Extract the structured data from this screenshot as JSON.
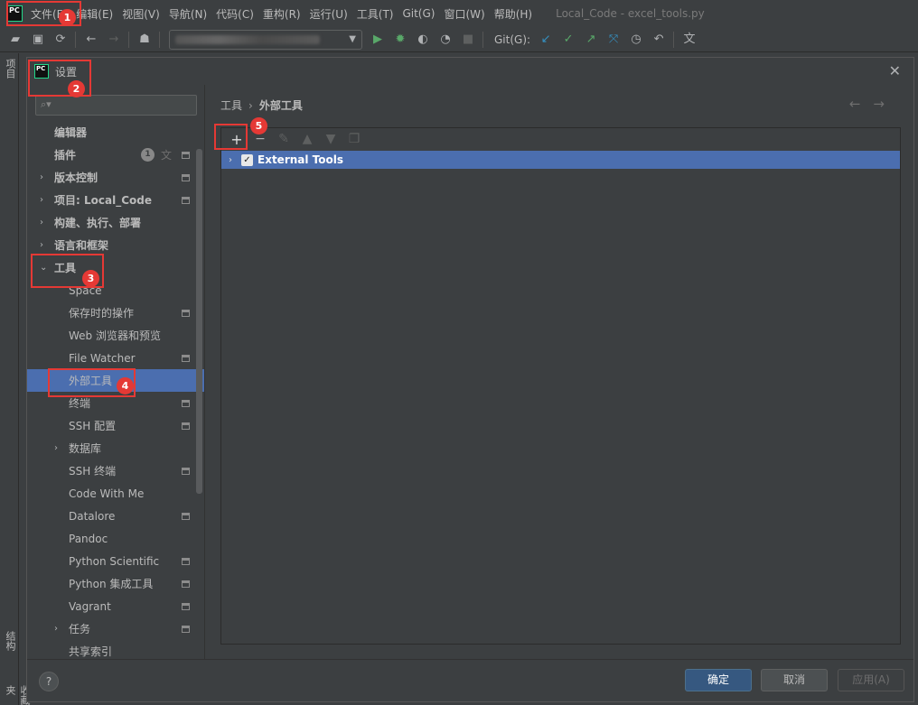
{
  "menu": {
    "items": [
      "文件(F)",
      "编辑(E)",
      "视图(V)",
      "导航(N)",
      "代码(C)",
      "重构(R)",
      "运行(U)",
      "工具(T)",
      "Git(G)",
      "窗口(W)",
      "帮助(H)"
    ],
    "window_title": "Local_Code - excel_tools.py"
  },
  "toolbar": {
    "git_label": "Git(G):"
  },
  "side_strip": {
    "project_tab": "项目",
    "structure_tab": "结构",
    "bookmarks_tab": "收藏夹"
  },
  "dialog": {
    "title": "设置",
    "search_placeholder": "",
    "tree": [
      {
        "label": "编辑器",
        "level": 0,
        "arrow": "",
        "scope": false,
        "badge": "",
        "trans": false
      },
      {
        "label": "插件",
        "level": 0,
        "arrow": "",
        "scope": true,
        "badge": "1",
        "trans": true
      },
      {
        "label": "版本控制",
        "level": 0,
        "arrow": "›",
        "scope": true,
        "badge": "",
        "trans": false
      },
      {
        "label": "项目: Local_Code",
        "level": 0,
        "arrow": "›",
        "scope": true,
        "badge": "",
        "trans": false
      },
      {
        "label": "构建、执行、部署",
        "level": 0,
        "arrow": "›",
        "scope": false,
        "badge": "",
        "trans": false
      },
      {
        "label": "语言和框架",
        "level": 0,
        "arrow": "›",
        "scope": false,
        "badge": "",
        "trans": false
      },
      {
        "label": "工具",
        "level": 0,
        "arrow": "⌄",
        "scope": false,
        "badge": "",
        "trans": false
      },
      {
        "label": "Space",
        "level": 1,
        "arrow": "",
        "scope": false,
        "badge": "",
        "trans": false
      },
      {
        "label": "保存时的操作",
        "level": 1,
        "arrow": "",
        "scope": true,
        "badge": "",
        "trans": false
      },
      {
        "label": "Web 浏览器和预览",
        "level": 1,
        "arrow": "",
        "scope": false,
        "badge": "",
        "trans": false
      },
      {
        "label": "File Watcher",
        "level": 1,
        "arrow": "",
        "scope": true,
        "badge": "",
        "trans": false
      },
      {
        "label": "外部工具",
        "level": 1,
        "arrow": "",
        "scope": false,
        "badge": "",
        "trans": false,
        "selected": true
      },
      {
        "label": "终端",
        "level": 1,
        "arrow": "",
        "scope": true,
        "badge": "",
        "trans": false
      },
      {
        "label": "SSH 配置",
        "level": 1,
        "arrow": "",
        "scope": true,
        "badge": "",
        "trans": false
      },
      {
        "label": "数据库",
        "level": 1,
        "arrow": "›",
        "scope": false,
        "badge": "",
        "trans": false
      },
      {
        "label": "SSH 终端",
        "level": 1,
        "arrow": "",
        "scope": true,
        "badge": "",
        "trans": false
      },
      {
        "label": "Code With Me",
        "level": 1,
        "arrow": "",
        "scope": false,
        "badge": "",
        "trans": false
      },
      {
        "label": "Datalore",
        "level": 1,
        "arrow": "",
        "scope": true,
        "badge": "",
        "trans": false
      },
      {
        "label": "Pandoc",
        "level": 1,
        "arrow": "",
        "scope": false,
        "badge": "",
        "trans": false
      },
      {
        "label": "Python Scientific",
        "level": 1,
        "arrow": "",
        "scope": true,
        "badge": "",
        "trans": false
      },
      {
        "label": "Python 集成工具",
        "level": 1,
        "arrow": "",
        "scope": true,
        "badge": "",
        "trans": false
      },
      {
        "label": "Vagrant",
        "level": 1,
        "arrow": "",
        "scope": true,
        "badge": "",
        "trans": false
      },
      {
        "label": "任务",
        "level": 1,
        "arrow": "›",
        "scope": true,
        "badge": "",
        "trans": false
      },
      {
        "label": "共享索引",
        "level": 1,
        "arrow": "",
        "scope": false,
        "badge": "",
        "trans": false
      }
    ],
    "breadcrumb": [
      "工具",
      "外部工具"
    ],
    "tools_list": [
      {
        "name": "External Tools",
        "checked": true
      }
    ],
    "buttons": {
      "ok": "确定",
      "cancel": "取消",
      "apply": "应用(A)",
      "help": "?"
    }
  },
  "annotations": [
    "1",
    "2",
    "3",
    "4",
    "5"
  ],
  "colors": {
    "selection": "#4b6eaf",
    "annotation": "#e53935",
    "primary_button": "#365880"
  }
}
